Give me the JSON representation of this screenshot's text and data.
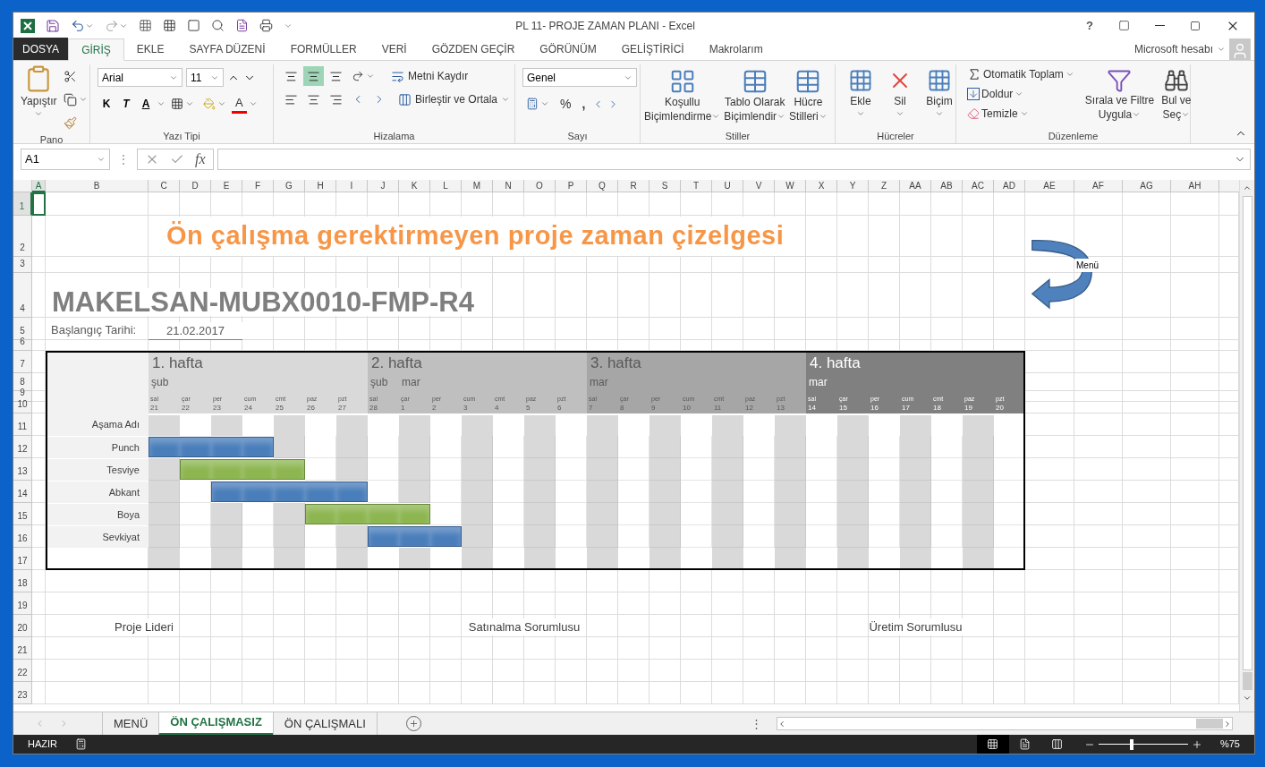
{
  "title_bar": {
    "title": "PL 11- PROJE ZAMAN PLANI - Excel",
    "help": "?"
  },
  "ribbon_tabs": [
    {
      "label": "DOSYA",
      "kind": "file",
      "selected": false
    },
    {
      "label": "GİRİŞ",
      "kind": "tab",
      "selected": true
    },
    {
      "label": "EKLE",
      "kind": "tab",
      "selected": false
    },
    {
      "label": "SAYFA DÜZENİ",
      "kind": "tab",
      "selected": false
    },
    {
      "label": "FORMÜLLER",
      "kind": "tab",
      "selected": false
    },
    {
      "label": "VERİ",
      "kind": "tab",
      "selected": false
    },
    {
      "label": "GÖZDEN GEÇİR",
      "kind": "tab",
      "selected": false
    },
    {
      "label": "GÖRÜNÜM",
      "kind": "tab",
      "selected": false
    },
    {
      "label": "GELİŞTİRİCİ",
      "kind": "tab",
      "selected": false
    },
    {
      "label": "Makrolarım",
      "kind": "tab",
      "selected": false
    }
  ],
  "account": "Microsoft hesabı",
  "ribbon": {
    "clipboard": {
      "group": "Pano",
      "paste": "Yapıştır"
    },
    "font": {
      "group": "Yazı Tipi",
      "name": "Arial",
      "size": "11",
      "bold": "K",
      "italic": "T",
      "underline": "A",
      "font_color": "A"
    },
    "alignment": {
      "group": "Hizalama",
      "vertical": [
        {
          "selected": false
        },
        {
          "selected": true
        },
        {
          "selected": false
        }
      ],
      "wrap": "Metni Kaydır",
      "merge": "Birleştir ve Ortala"
    },
    "number": {
      "group": "Sayı",
      "format": "Genel",
      "percent": "%",
      "comma": ","
    },
    "styles": {
      "group": "Stiller",
      "buttons": [
        {
          "lines": [
            "Koşullu",
            "Biçimlendirme"
          ]
        },
        {
          "lines": [
            "Tablo Olarak",
            "Biçimlendir"
          ]
        },
        {
          "lines": [
            "Hücre",
            "Stilleri"
          ]
        }
      ]
    },
    "cells": {
      "group": "Hücreler",
      "buttons": [
        "Ekle",
        "Sil",
        "Biçim"
      ]
    },
    "editing": {
      "group": "Düzenleme",
      "autosum": "Otomatik Toplam",
      "fill": "Doldur",
      "clear": "Temizle",
      "sort": [
        "Sırala ve Filtre",
        "Uygula"
      ],
      "find": [
        "Bul ve",
        "Seç"
      ]
    }
  },
  "formula_bar": {
    "name_box": "A1",
    "divider": "⋮",
    "fx": "fx"
  },
  "sheet": {
    "columns": [
      {
        "label": "A",
        "selected": true
      },
      {
        "label": "B",
        "selected": false
      },
      {
        "label": "C",
        "selected": false
      },
      {
        "label": "D",
        "selected": false
      },
      {
        "label": "E",
        "selected": false
      },
      {
        "label": "F",
        "selected": false
      },
      {
        "label": "G",
        "selected": false
      },
      {
        "label": "H",
        "selected": false
      },
      {
        "label": "I",
        "selected": false
      },
      {
        "label": "J",
        "selected": false
      },
      {
        "label": "K",
        "selected": false
      },
      {
        "label": "L",
        "selected": false
      },
      {
        "label": "M",
        "selected": false
      },
      {
        "label": "N",
        "selected": false
      },
      {
        "label": "O",
        "selected": false
      },
      {
        "label": "P",
        "selected": false
      },
      {
        "label": "Q",
        "selected": false
      },
      {
        "label": "R",
        "selected": false
      },
      {
        "label": "S",
        "selected": false
      },
      {
        "label": "T",
        "selected": false
      },
      {
        "label": "U",
        "selected": false
      },
      {
        "label": "V",
        "selected": false
      },
      {
        "label": "W",
        "selected": false
      },
      {
        "label": "X",
        "selected": false
      },
      {
        "label": "Y",
        "selected": false
      },
      {
        "label": "Z",
        "selected": false
      },
      {
        "label": "AA",
        "selected": false
      },
      {
        "label": "AB",
        "selected": false
      },
      {
        "label": "AC",
        "selected": false
      },
      {
        "label": "AD",
        "selected": false
      },
      {
        "label": "AE",
        "selected": false
      },
      {
        "label": "AF",
        "selected": false
      },
      {
        "label": "AG",
        "selected": false
      },
      {
        "label": "AH",
        "selected": false
      }
    ],
    "rows": [
      {
        "label": "1",
        "selected": true
      },
      {
        "label": "2",
        "selected": false
      },
      {
        "label": "3",
        "selected": false
      },
      {
        "label": "4",
        "selected": false
      },
      {
        "label": "5",
        "selected": false
      },
      {
        "label": "6",
        "selected": false
      },
      {
        "label": "7",
        "selected": false
      },
      {
        "label": "8",
        "selected": false
      },
      {
        "label": "9",
        "selected": false
      },
      {
        "label": "10",
        "selected": false
      },
      {
        "label": "11",
        "selected": false
      },
      {
        "label": "12",
        "selected": false
      },
      {
        "label": "13",
        "selected": false
      },
      {
        "label": "14",
        "selected": false
      },
      {
        "label": "15",
        "selected": false
      },
      {
        "label": "16",
        "selected": false
      },
      {
        "label": "17",
        "selected": false
      },
      {
        "label": "18",
        "selected": false
      },
      {
        "label": "19",
        "selected": false
      },
      {
        "label": "20",
        "selected": false
      },
      {
        "label": "21",
        "selected": false
      },
      {
        "label": "22",
        "selected": false
      },
      {
        "label": "23",
        "selected": false
      }
    ],
    "title": "Ön çalışma gerektirmeyen proje zaman çizelgesi",
    "code": "MAKELSAN-MUBX0010-FMP-R4",
    "start_label": "Başlangıç Tarihi:",
    "start_date": "21.02.2017",
    "menu_shape": {
      "label": "Menü"
    },
    "gantt": {
      "weeks": [
        {
          "label": "1. hafta",
          "color": "#d9d9d9",
          "days": [
            {
              "month": "şub",
              "dow": "sal",
              "day": "21"
            },
            {
              "dow": "çar",
              "day": "22"
            },
            {
              "dow": "per",
              "day": "23"
            },
            {
              "dow": "cum",
              "day": "24"
            },
            {
              "dow": "cmt",
              "day": "25"
            },
            {
              "dow": "paz",
              "day": "26"
            },
            {
              "dow": "pzt",
              "day": "27"
            }
          ]
        },
        {
          "label": "2. hafta",
          "color": "#bfbfbf",
          "days": [
            {
              "month": "şub",
              "dow": "sal",
              "day": "28"
            },
            {
              "month": "mar",
              "dow": "çar",
              "day": "1"
            },
            {
              "dow": "per",
              "day": "2"
            },
            {
              "dow": "cum",
              "day": "3"
            },
            {
              "dow": "cmt",
              "day": "4"
            },
            {
              "dow": "paz",
              "day": "5"
            },
            {
              "dow": "pzt",
              "day": "6"
            }
          ]
        },
        {
          "label": "3. hafta",
          "color": "#a6a6a6",
          "days": [
            {
              "month": "mar",
              "dow": "sal",
              "day": "7"
            },
            {
              "dow": "çar",
              "day": "8"
            },
            {
              "dow": "per",
              "day": "9"
            },
            {
              "dow": "cum",
              "day": "10"
            },
            {
              "dow": "cmt",
              "day": "11"
            },
            {
              "dow": "paz",
              "day": "12"
            },
            {
              "dow": "pzt",
              "day": "13"
            }
          ]
        },
        {
          "label": "4. hafta",
          "color": "#808080",
          "days": [
            {
              "month": "mar",
              "dow": "sal",
              "day": "14"
            },
            {
              "dow": "çar",
              "day": "15"
            },
            {
              "dow": "per",
              "day": "16"
            },
            {
              "dow": "cum",
              "day": "17"
            },
            {
              "dow": "cmt",
              "day": "18"
            },
            {
              "dow": "paz",
              "day": "19"
            },
            {
              "dow": "pzt",
              "day": "20"
            }
          ]
        }
      ],
      "header": "Aşama Adı",
      "tasks": [
        {
          "name": "Punch",
          "color": "#4a7ebb",
          "active": [
            true,
            true,
            true,
            true,
            false,
            false,
            false,
            false,
            false,
            false,
            false,
            false,
            false,
            false,
            false,
            false,
            false,
            false,
            false,
            false,
            false,
            false,
            false,
            false,
            false,
            false,
            false,
            false
          ]
        },
        {
          "name": "Tesviye",
          "color": "#8db651",
          "active": [
            false,
            true,
            true,
            true,
            true,
            false,
            false,
            false,
            false,
            false,
            false,
            false,
            false,
            false,
            false,
            false,
            false,
            false,
            false,
            false,
            false,
            false,
            false,
            false,
            false,
            false,
            false,
            false
          ]
        },
        {
          "name": "Abkant",
          "color": "#4a7ebb",
          "active": [
            false,
            false,
            true,
            true,
            true,
            true,
            true,
            false,
            false,
            false,
            false,
            false,
            false,
            false,
            false,
            false,
            false,
            false,
            false,
            false,
            false,
            false,
            false,
            false,
            false,
            false,
            false,
            false
          ]
        },
        {
          "name": "Boya",
          "color": "#8db651",
          "active": [
            false,
            false,
            false,
            false,
            false,
            true,
            true,
            true,
            true,
            false,
            false,
            false,
            false,
            false,
            false,
            false,
            false,
            false,
            false,
            false,
            false,
            false,
            false,
            false,
            false,
            false,
            false,
            false
          ]
        },
        {
          "name": "Sevkiyat",
          "color": "#4a7ebb",
          "active": [
            false,
            false,
            false,
            false,
            false,
            false,
            false,
            true,
            true,
            true,
            false,
            false,
            false,
            false,
            false,
            false,
            false,
            false,
            false,
            false,
            false,
            false,
            false,
            false,
            false,
            false,
            false,
            false
          ]
        }
      ]
    },
    "signatures": [
      "Proje Lideri",
      "Satınalma Sorumlusu",
      "Üretim Sorumlusu"
    ]
  },
  "sheet_tabs": [
    {
      "label": "MENÜ",
      "selected": false
    },
    {
      "label": "ÖN ÇALIŞMASIZ",
      "selected": true
    },
    {
      "label": "ÖN ÇALIŞMALI",
      "selected": false
    }
  ],
  "tab_bar": {
    "divider": "⋮"
  },
  "status_bar": {
    "mode": "HAZIR",
    "views": [
      {
        "selected": true
      },
      {
        "selected": false
      },
      {
        "selected": false
      }
    ],
    "zoom_slider": {
      "level": 0.37
    },
    "zoom": "%75"
  }
}
